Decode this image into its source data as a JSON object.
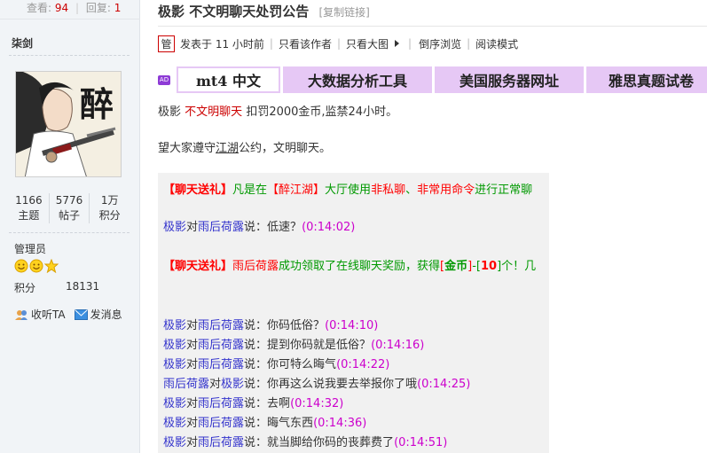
{
  "stats": {
    "views_label": "查看:",
    "views": "94",
    "replies_label": "回复:",
    "replies": "1"
  },
  "user": {
    "name": "柒剑",
    "avatar_char": "醉",
    "counts": [
      {
        "value": "1166",
        "label": "主题"
      },
      {
        "value": "5776",
        "label": "帖子"
      },
      {
        "value": "1万",
        "label": "积分"
      }
    ],
    "role": "管理员",
    "score_label": "积分",
    "score": "18131",
    "follow_label": "收听TA",
    "message_label": "发消息"
  },
  "thread": {
    "title": "极影 不文明聊天处罚公告",
    "copy_link": "[复制链接]"
  },
  "meta": {
    "badge": "管",
    "posted": "发表于 11 小时前",
    "author_only": "只看该作者",
    "big_image": "只看大图",
    "reverse": "倒序浏览",
    "read_mode": "阅读模式"
  },
  "ads": {
    "badge": "AD",
    "items": [
      "mt4 中文",
      "大数据分析工具",
      "美国服务器网址",
      "雅思真题试卷"
    ]
  },
  "post": {
    "penalty": {
      "a": "极影",
      "b": "不文明聊天",
      "c": "扣罚2000金币,监禁24小时。"
    },
    "advice": {
      "a": "望大家遵守",
      "b": "江湖",
      "c": "公约，文明聊天。"
    }
  },
  "chat": {
    "line1": {
      "a": "【聊天送礼】",
      "b": "凡是在",
      "c": "【醉江湖】",
      "d": "大厅使用",
      "e": "非私聊",
      "f": "、",
      "g": "非常用命令",
      "h": "进行正常聊"
    },
    "line2": {
      "a": "极影",
      "b": "对",
      "c": "雨后荷露",
      "d": "说：低速？",
      "e": "(0:14:02)"
    },
    "line3": {
      "a": "【聊天送礼】",
      "b": "雨后荷露",
      "c": "成功领取了在线聊天奖励，获得",
      "d": "[",
      "e": "金币",
      "f": "]",
      "g": "-[",
      "h": "10",
      "i": "]个！几"
    },
    "msgs": [
      {
        "a": "极影",
        "b": "对",
        "c": "雨后荷露",
        "d": "说：你码低俗？",
        "e": "(0:14:10)"
      },
      {
        "a": "极影",
        "b": "对",
        "c": "雨后荷露",
        "d": "说：提到你码就是低俗？",
        "e": "(0:14:16)"
      },
      {
        "a": "极影",
        "b": "对",
        "c": "雨后荷露",
        "d": "说：你可特么晦气",
        "e": "(0:14:22)"
      },
      {
        "a": "雨后荷露",
        "b": "对",
        "c": "极影",
        "d": "说：你再这么说我要去举报你了哦",
        "e": "(0:14:25)"
      },
      {
        "a": "极影",
        "b": "对",
        "c": "雨后荷露",
        "d": "说：去啊",
        "e": "(0:14:32)"
      },
      {
        "a": "极影",
        "b": "对",
        "c": "雨后荷露",
        "d": "说：晦气东西",
        "e": "(0:14:36)"
      },
      {
        "a": "极影",
        "b": "对",
        "c": "雨后荷露",
        "d": "说：就当脚给你码的丧葬费了",
        "e": "(0:14:51)"
      }
    ]
  }
}
